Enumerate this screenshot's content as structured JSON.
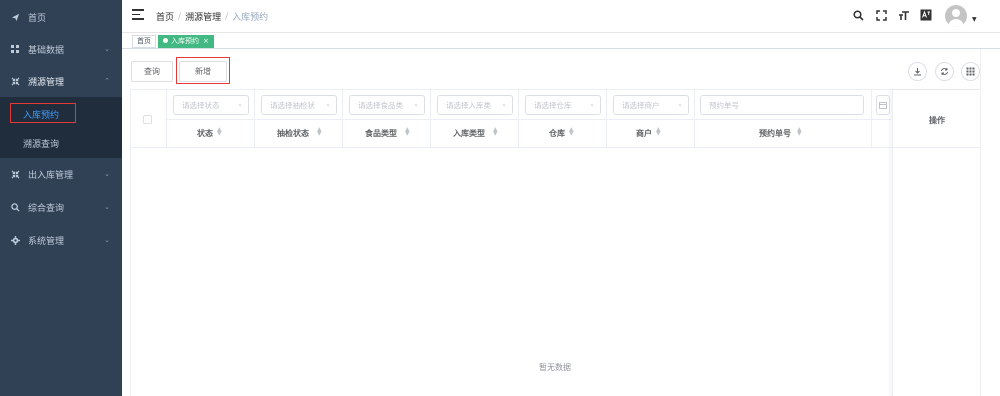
{
  "sidebar": {
    "items": [
      {
        "label": "首页",
        "icon": "send-icon"
      },
      {
        "label": "基础数据",
        "icon": "grid-icon"
      },
      {
        "label": "溯源管理",
        "icon": "shrink-icon"
      },
      {
        "label": "出入库管理",
        "icon": "shrink-icon"
      },
      {
        "label": "综合查询",
        "icon": "search-icon"
      },
      {
        "label": "系统管理",
        "icon": "gear-icon"
      }
    ],
    "submenu": [
      {
        "label": "入库预约"
      },
      {
        "label": "溯源查询"
      }
    ]
  },
  "navbar": {
    "breadcrumb": [
      "首页",
      "溯源管理",
      "入库预约"
    ],
    "separator": "/"
  },
  "tags": {
    "home": "首页",
    "active": "入库预约",
    "close": "×"
  },
  "toolbar": {
    "query_label": "查询",
    "add_label": "新增"
  },
  "table": {
    "filters": [
      {
        "placeholder": "请选择状态"
      },
      {
        "placeholder": "请选择抽检状"
      },
      {
        "placeholder": "请选择食品类"
      },
      {
        "placeholder": "请选择入库类"
      },
      {
        "placeholder": "请选择仓库"
      },
      {
        "placeholder": "请选择商户"
      },
      {
        "placeholder": "预约单号"
      }
    ],
    "columns": [
      "状态",
      "抽检状态",
      "食品类型",
      "入库类型",
      "仓库",
      "商户",
      "预约单号"
    ],
    "ops_label": "操作",
    "empty_text": "暂无数据"
  },
  "colors": {
    "sidebar_bg": "#304156",
    "submenu_bg": "#1f2d3d",
    "active_menu": "#409eff",
    "active_tag": "#42b983",
    "highlight": "#e53935"
  }
}
